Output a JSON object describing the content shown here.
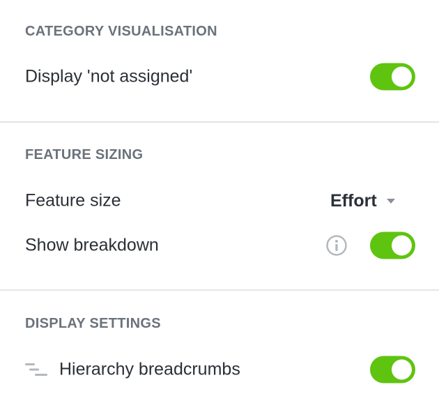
{
  "sections": [
    {
      "title": "CATEGORY VISUALISATION",
      "rows": [
        {
          "label": "Display 'not assigned'",
          "toggle_on": true
        }
      ]
    },
    {
      "title": "FEATURE SIZING",
      "rows": [
        {
          "label": "Feature size",
          "select_value": "Effort"
        },
        {
          "label": "Show breakdown",
          "toggle_on": true,
          "icon": "info-icon"
        }
      ]
    },
    {
      "title": "DISPLAY SETTINGS",
      "rows": [
        {
          "label": "Hierarchy breadcrumbs",
          "toggle_on": true,
          "icon": "hierarchy-icon"
        }
      ]
    }
  ],
  "colors": {
    "toggle_on": "#5fc410",
    "section_title": "#6b727b",
    "text": "#2b3036",
    "divider": "#e3e5e8",
    "icon_gray": "#b3b8be"
  }
}
